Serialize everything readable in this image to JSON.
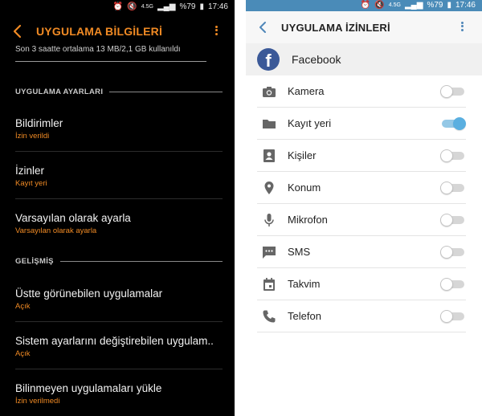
{
  "status_bar": {
    "battery": "%79",
    "time": "17:46",
    "network": "4.5G"
  },
  "left": {
    "title": "UYGULAMA BİLGİLERİ",
    "usage_text": "Son 3 saatte ortalama 13 MB/2,1 GB kullanıldı",
    "sections": [
      {
        "label": "UYGULAMA AYARLARI"
      },
      {
        "label": "GELİŞMİŞ"
      }
    ],
    "items": [
      {
        "title": "Bildirimler",
        "subtitle": "İzin verildi"
      },
      {
        "title": "İzinler",
        "subtitle": "Kayıt yeri"
      },
      {
        "title": "Varsayılan olarak ayarla",
        "subtitle": "Varsayılan olarak ayarla"
      },
      {
        "title": "Üstte görünebilen uygulamalar",
        "subtitle": "Açık"
      },
      {
        "title": "Sistem ayarlarını değiştirebilen uygulam..",
        "subtitle": "Açık"
      },
      {
        "title": "Bilinmeyen uygulamaları yükle",
        "subtitle": "İzin verilmedi"
      }
    ],
    "accent_color": "#f08a24"
  },
  "right": {
    "title": "UYGULAMA İZİNLERİ",
    "app_name": "Facebook",
    "app_icon_letter": "f",
    "permissions": [
      {
        "name": "Kamera",
        "icon": "camera-icon",
        "enabled": false
      },
      {
        "name": "Kayıt yeri",
        "icon": "folder-icon",
        "enabled": true
      },
      {
        "name": "Kişiler",
        "icon": "contacts-icon",
        "enabled": false
      },
      {
        "name": "Konum",
        "icon": "location-icon",
        "enabled": false
      },
      {
        "name": "Mikrofon",
        "icon": "microphone-icon",
        "enabled": false
      },
      {
        "name": "SMS",
        "icon": "sms-icon",
        "enabled": false
      },
      {
        "name": "Takvim",
        "icon": "calendar-icon",
        "enabled": false
      },
      {
        "name": "Telefon",
        "icon": "phone-icon",
        "enabled": false
      }
    ],
    "accent_color": "#4f86b8"
  }
}
